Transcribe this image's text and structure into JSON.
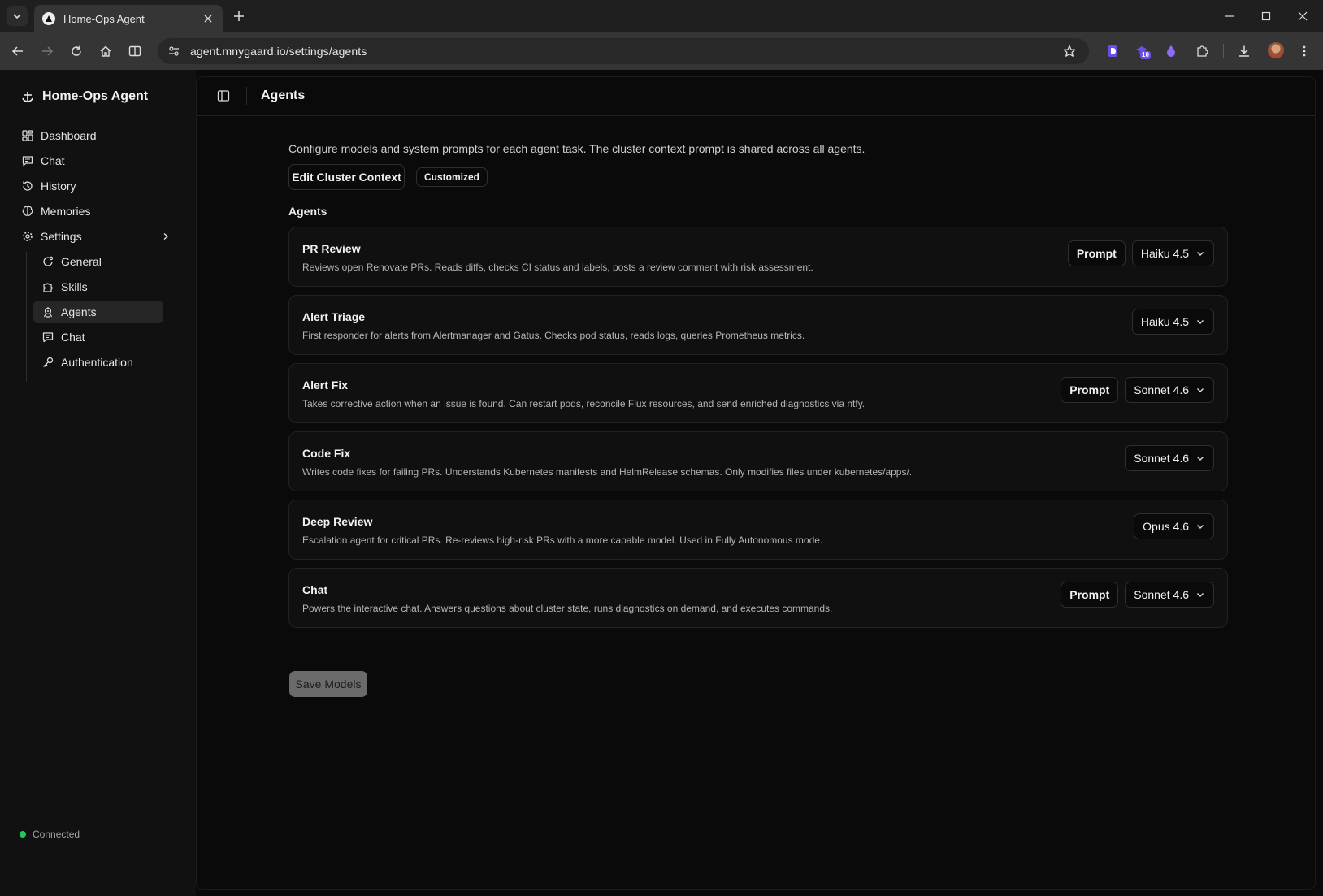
{
  "browser": {
    "tab_title": "Home-Ops Agent",
    "url": "agent.mnygaard.io/settings/agents",
    "extension_badge": "10"
  },
  "sidebar": {
    "app_name": "Home-Ops Agent",
    "items": [
      {
        "label": "Dashboard",
        "icon": "dashboard-icon"
      },
      {
        "label": "Chat",
        "icon": "chat-icon"
      },
      {
        "label": "History",
        "icon": "history-icon"
      },
      {
        "label": "Memories",
        "icon": "brain-icon"
      },
      {
        "label": "Settings",
        "icon": "gear-icon"
      }
    ],
    "settings_items": [
      {
        "label": "General",
        "icon": "general-icon"
      },
      {
        "label": "Skills",
        "icon": "puzzle-icon"
      },
      {
        "label": "Agents",
        "icon": "bot-icon",
        "active": true
      },
      {
        "label": "Chat",
        "icon": "chat-icon"
      },
      {
        "label": "Authentication",
        "icon": "key-icon"
      }
    ],
    "status": "Connected",
    "status_color": "#22c55e"
  },
  "header": {
    "title": "Agents"
  },
  "main": {
    "intro": "Configure models and system prompts for each agent task. The cluster context prompt is shared across all agents.",
    "edit_context_label": "Edit Cluster Context",
    "customized_badge": "Customized",
    "section_title": "Agents",
    "prompt_label": "Prompt",
    "agents": [
      {
        "name": "PR Review",
        "description": "Reviews open Renovate PRs. Reads diffs, checks CI status and labels, posts a review comment with risk assessment.",
        "has_prompt": true,
        "model": "Haiku 4.5"
      },
      {
        "name": "Alert Triage",
        "description": "First responder for alerts from Alertmanager and Gatus. Checks pod status, reads logs, queries Prometheus metrics.",
        "has_prompt": false,
        "model": "Haiku 4.5"
      },
      {
        "name": "Alert Fix",
        "description": "Takes corrective action when an issue is found. Can restart pods, reconcile Flux resources, and send enriched diagnostics via ntfy.",
        "has_prompt": true,
        "model": "Sonnet 4.6"
      },
      {
        "name": "Code Fix",
        "description": "Writes code fixes for failing PRs. Understands Kubernetes manifests and HelmRelease schemas. Only modifies files under kubernetes/apps/.",
        "has_prompt": false,
        "model": "Sonnet 4.6"
      },
      {
        "name": "Deep Review",
        "description": "Escalation agent for critical PRs. Re-reviews high-risk PRs with a more capable model. Used in Fully Autonomous mode.",
        "has_prompt": false,
        "model": "Opus 4.6"
      },
      {
        "name": "Chat",
        "description": "Powers the interactive chat. Answers questions about cluster state, runs diagnostics on demand, and executes commands.",
        "has_prompt": true,
        "model": "Sonnet 4.6"
      }
    ],
    "save_label": "Save Models"
  }
}
